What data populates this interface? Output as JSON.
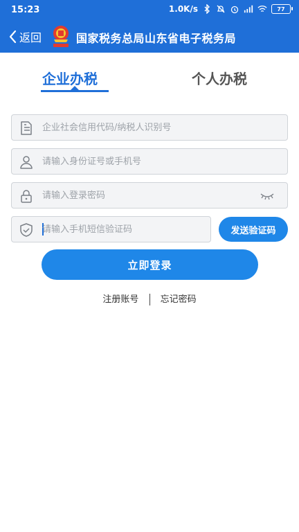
{
  "status_bar": {
    "time": "15:23",
    "net_speed": "1.0K/s",
    "battery": "77"
  },
  "nav": {
    "back_label": "返回",
    "title": "国家税务总局山东省电子税务局"
  },
  "tabs": [
    {
      "label": "企业办税",
      "active": true
    },
    {
      "label": "个人办税",
      "active": false
    }
  ],
  "form": {
    "credit_code_placeholder": "企业社会信用代码/纳税人识别号",
    "id_phone_placeholder": "请输入身份证号或手机号",
    "password_placeholder": "请输入登录密码",
    "sms_code_placeholder": "请输入手机短信验证码",
    "send_code_label": "发送验证码",
    "login_label": "立即登录"
  },
  "links": {
    "register": "注册账号",
    "forgot": "忘记密码"
  },
  "colors": {
    "primary": "#1f6fd8",
    "button": "#1f87e8"
  }
}
